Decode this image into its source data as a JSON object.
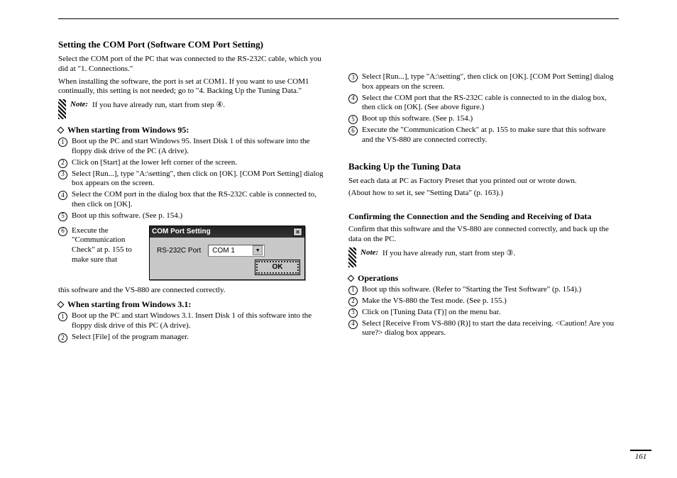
{
  "page_number": "161",
  "hr": true,
  "left": {
    "title": "Setting the COM Port (Software COM Port Setting)",
    "intro1": "Select the COM port of the PC that was connected to the RS-232C cable, which you did at \"1. Connections.\"",
    "intro2": "When installing the software, the port is set at COM1. If you want to use COM1 continually, this setting is not needed; go to \"4. Backing Up the Tuning Data.\"",
    "note": {
      "label": "Note:",
      "text": "If you have already run, start from step ④."
    },
    "block_a": {
      "label": "When starting from Windows 95:",
      "steps": [
        "Boot up the PC and start Windows 95. Insert Disk 1 of this software into the floppy disk drive of the PC (A drive).",
        "Click on [Start] at the lower left corner of the screen.",
        "Select [Run...], type \"A:\\setting\", then click on [OK]. [COM Port Setting] dialog box appears on the screen.",
        "Select the COM port in the dialog box that the RS-232C cable is connected to, then click on [OK].",
        "Boot up this software. (See p. 154.)"
      ],
      "dialog": {
        "title": "COM Port Setting",
        "label": "RS-232C Port",
        "value": "COM 1",
        "ok": "OK"
      }
    },
    "block_b": {
      "label": "When starting from Windows 3.1:",
      "steps": [
        "Boot up the PC and start Windows 3.1. Insert Disk 1 of this software into the floppy disk drive of this PC (A drive).",
        "Select [File] of the program manager."
      ]
    }
  },
  "right": {
    "pre_steps": [
      {
        "n": "3",
        "text": "Select [Run...], type \"A:\\setting\", then click on [OK]. [COM Port Setting] dialog box appears on the screen."
      },
      {
        "n": "4",
        "text": "Select the COM port that the RS-232C cable is connected to in the dialog box, then click on [OK]. (See above figure.)"
      },
      {
        "n": "5",
        "text": "Boot up this software. (See p. 154.)"
      },
      {
        "n": "6",
        "text": "Execute the \"Communication Check\" at p. 155 to make sure that this software and the VS-880 are connected correctly."
      }
    ],
    "section_title": "Backing Up the Tuning Data",
    "body1": "Set each data at PC as Factory Preset that you printed out or wrote down.",
    "body2": "(About how to set it, see \"Setting Data\" (p. 163).)",
    "sub_title": "Confirming the Connection and the Sending and Receiving of Data",
    "sub_body": "Confirm that this software and the VS-880 are connected correctly, and back up the data on the PC.",
    "note": {
      "label": "Note:",
      "text": "If you have already run, start from step ③."
    },
    "ops": {
      "label": "Operations",
      "steps": [
        "Boot up this software. (Refer to \"Starting the Test Software\" (p. 154).)",
        "Make the VS-880 the Test mode. (See p. 155.)",
        "Click on [Tuning Data (T)] on the menu bar.",
        "Select [Receive From VS-880 (R)] to start the data receiving. <Caution! Are you sure?> dialog box appears."
      ]
    }
  }
}
